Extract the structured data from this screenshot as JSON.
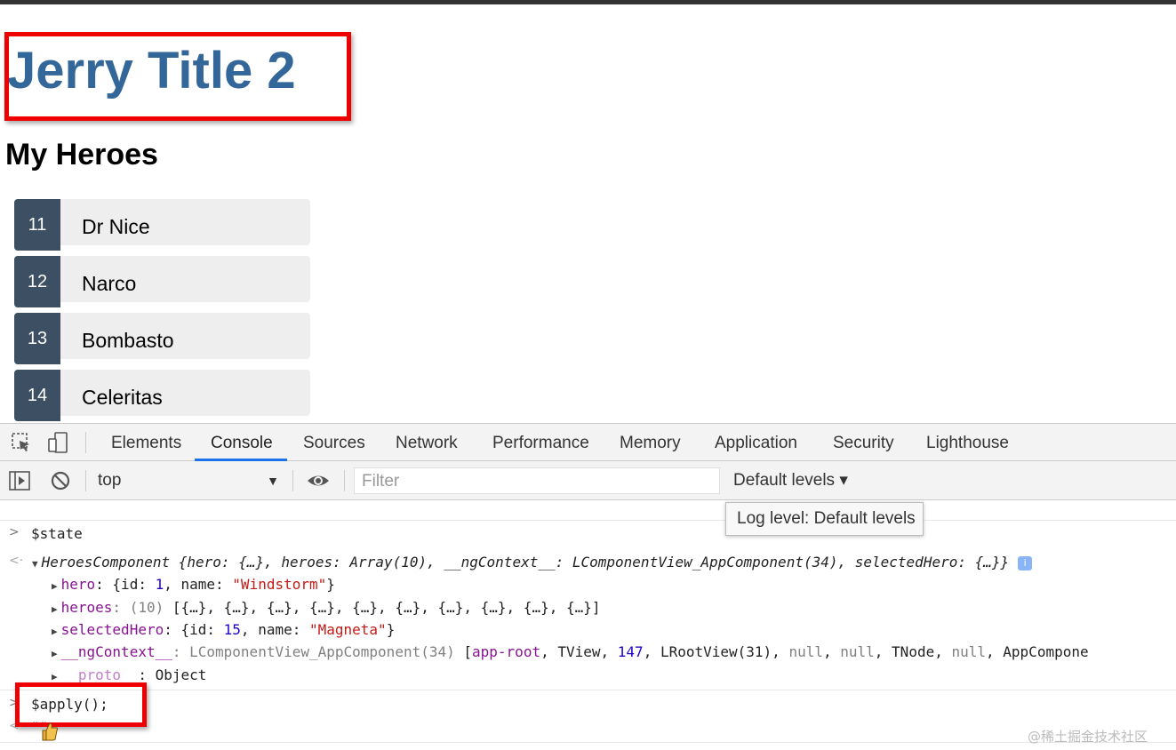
{
  "page": {
    "app_title": "Jerry Title 2",
    "section_title": "My Heroes",
    "heroes": [
      {
        "id": "11",
        "name": "Dr Nice"
      },
      {
        "id": "12",
        "name": "Narco"
      },
      {
        "id": "13",
        "name": "Bombasto"
      },
      {
        "id": "14",
        "name": "Celeritas"
      }
    ]
  },
  "devtools": {
    "tabs": [
      "Elements",
      "Console",
      "Sources",
      "Network",
      "Performance",
      "Memory",
      "Application",
      "Security",
      "Lighthouse"
    ],
    "active_tab": "Console",
    "toolbar": {
      "context": "top",
      "filter_placeholder": "Filter",
      "levels": "Default levels ▾",
      "tooltip": "Log level: Default levels"
    },
    "console": {
      "cmd1": "$state",
      "result_class": "HeroesComponent",
      "result_summary": " {hero: {…}, heroes: Array(10), __ngContext__: LComponentView_AppComponent(34), selectedHero: {…}}",
      "prop_hero_key": "hero",
      "prop_hero_val_pre": ": {id: ",
      "prop_hero_id": "1",
      "prop_hero_val_mid": ", name: ",
      "prop_hero_name": "\"Windstorm\"",
      "prop_hero_val_post": "}",
      "prop_heroes_key": "heroes",
      "prop_heroes_count": ": (10) ",
      "prop_heroes_val": "[{…}, {…}, {…}, {…}, {…}, {…}, {…}, {…}, {…}, {…}]",
      "prop_sel_key": "selectedHero",
      "prop_sel_val_pre": ": {id: ",
      "prop_sel_id": "15",
      "prop_sel_val_mid": ", name: ",
      "prop_sel_name": "\"Magneta\"",
      "prop_sel_val_post": "}",
      "prop_ctx_key": "__ngContext__",
      "prop_ctx_type": ": LComponentView_AppComponent(34) ",
      "prop_ctx_pre": "[",
      "prop_ctx_a": "app-root",
      "prop_ctx_b": ", TView, ",
      "prop_ctx_num": "147",
      "prop_ctx_c": ", LRootView(31), ",
      "prop_ctx_n1": "null",
      "prop_ctx_sep1": ", ",
      "prop_ctx_n2": "null",
      "prop_ctx_d": ", TNode, ",
      "prop_ctx_n3": "null",
      "prop_ctx_e": ", AppCompone",
      "prop_proto_key": "__proto__",
      "prop_proto_val": ": Object",
      "cmd2": "$apply();",
      "result2": "\"\""
    }
  },
  "watermark": "@稀土掘金技术社区",
  "colors": {
    "title": "#336699",
    "hero_badge": "#3d4f63",
    "highlight": "#ee0000",
    "active_tab": "#1a73e8"
  }
}
